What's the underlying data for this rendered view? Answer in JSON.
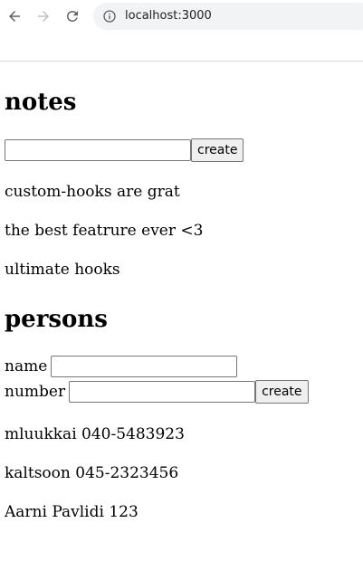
{
  "browser": {
    "url": "localhost:3000"
  },
  "notes": {
    "title": "notes",
    "input_value": "",
    "create_label": "create",
    "items": [
      "custom-hooks are grat",
      "the best featrure ever <3",
      "ultimate hooks"
    ]
  },
  "persons": {
    "title": "persons",
    "name_label": "name",
    "name_value": "",
    "number_label": "number",
    "number_value": "",
    "create_label": "create",
    "items": [
      "mluukkai 040-5483923",
      "kaltsoon 045-2323456",
      "Aarni Pavlidi 123"
    ]
  }
}
